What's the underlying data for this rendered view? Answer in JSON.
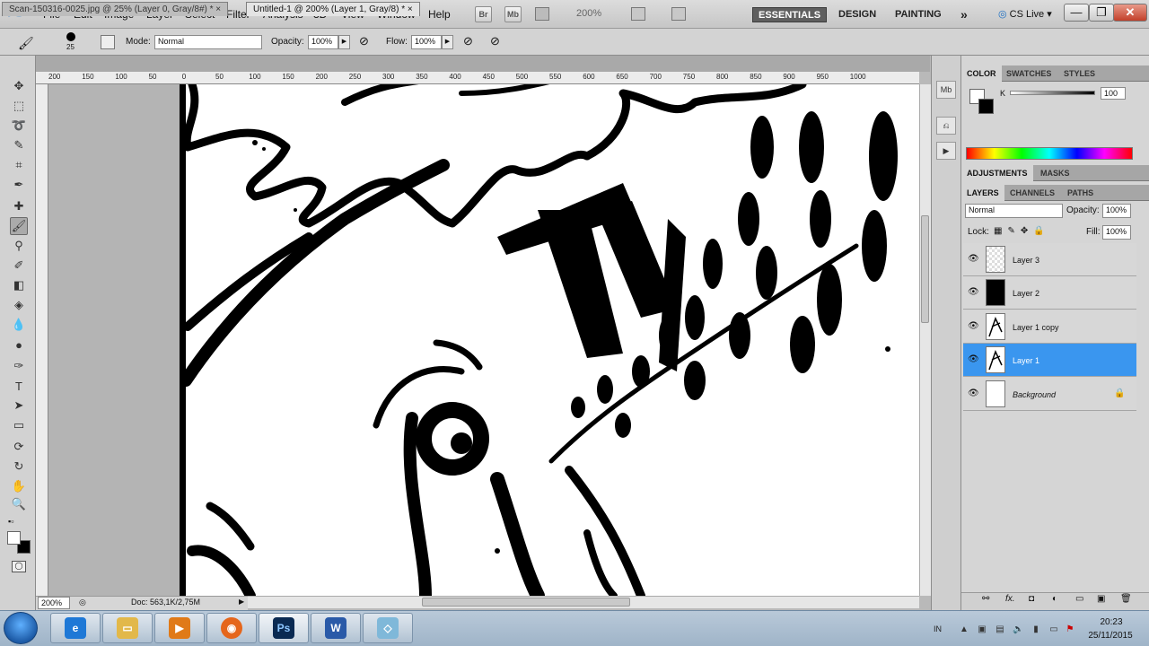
{
  "app": {
    "logo": "Ps"
  },
  "menu": [
    "File",
    "Edit",
    "Image",
    "Layer",
    "Select",
    "Filter",
    "Analysis",
    "3D",
    "View",
    "Window",
    "Help"
  ],
  "appbar": {
    "br": "Br",
    "mb": "Mb",
    "zoom": "200%"
  },
  "workspaces": {
    "essentials": "ESSENTIALS",
    "design": "DESIGN",
    "painting": "PAINTING",
    "more": "»"
  },
  "cslive": "CS Live",
  "window_buttons": {
    "minimize": "—",
    "restore": "❐",
    "close": "✕"
  },
  "options": {
    "brush_size": "25",
    "mode_label": "Mode:",
    "mode_value": "Normal",
    "opacity_label": "Opacity:",
    "opacity_value": "100%",
    "flow_label": "Flow:",
    "flow_value": "100%"
  },
  "tabs": [
    {
      "label": "Scan-150316-0025.jpg @ 25% (Layer 0, Gray/8#) *",
      "close": "×"
    },
    {
      "label": "Untitled-1 @ 200% (Layer 1, Gray/8) *",
      "close": "×"
    }
  ],
  "ruler": {
    "labels": [
      "200",
      "150",
      "100",
      "50",
      "0",
      "50",
      "100",
      "150",
      "200",
      "250",
      "300",
      "350",
      "400",
      "450",
      "500",
      "550",
      "600",
      "650",
      "700",
      "750",
      "800",
      "850",
      "900",
      "950",
      "1000"
    ]
  },
  "status": {
    "zoom": "200%",
    "doc": "Doc: 563,1K/2,75M"
  },
  "color_panel": {
    "tabs": [
      "COLOR",
      "SWATCHES",
      "STYLES"
    ],
    "channel": "K",
    "value": "100"
  },
  "adjust_panel": {
    "tabs": [
      "ADJUSTMENTS",
      "MASKS"
    ]
  },
  "layers_panel": {
    "tabs": [
      "LAYERS",
      "CHANNELS",
      "PATHS"
    ],
    "blend_mode": "Normal",
    "opacity_label": "Opacity:",
    "opacity_value": "100%",
    "lock_label": "Lock:",
    "fill_label": "Fill:",
    "fill_value": "100%",
    "layers": [
      {
        "name": "Layer 3",
        "thumb": "transparent",
        "selected": false
      },
      {
        "name": "Layer 2",
        "thumb": "black",
        "selected": false
      },
      {
        "name": "Layer 1 copy",
        "thumb": "sketch",
        "selected": false
      },
      {
        "name": "Layer 1",
        "thumb": "sketch",
        "selected": true
      },
      {
        "name": "Background",
        "thumb": "white",
        "selected": false,
        "locked": true
      }
    ],
    "footer_icons": [
      "link-icon",
      "fx-icon",
      "mask-icon",
      "adjustment-icon",
      "group-icon",
      "new-layer-icon",
      "trash-icon"
    ]
  },
  "taskbar": {
    "apps": [
      "Internet Explorer",
      "Windows Explorer",
      "Windows Media Player",
      "Firefox",
      "Photoshop",
      "Word",
      "Other"
    ],
    "lang": "IN",
    "time": "20:23",
    "date": "25/11/2015"
  },
  "colors": {
    "accent": "#3a96ef",
    "workspace_active": "#5f5f5f"
  }
}
